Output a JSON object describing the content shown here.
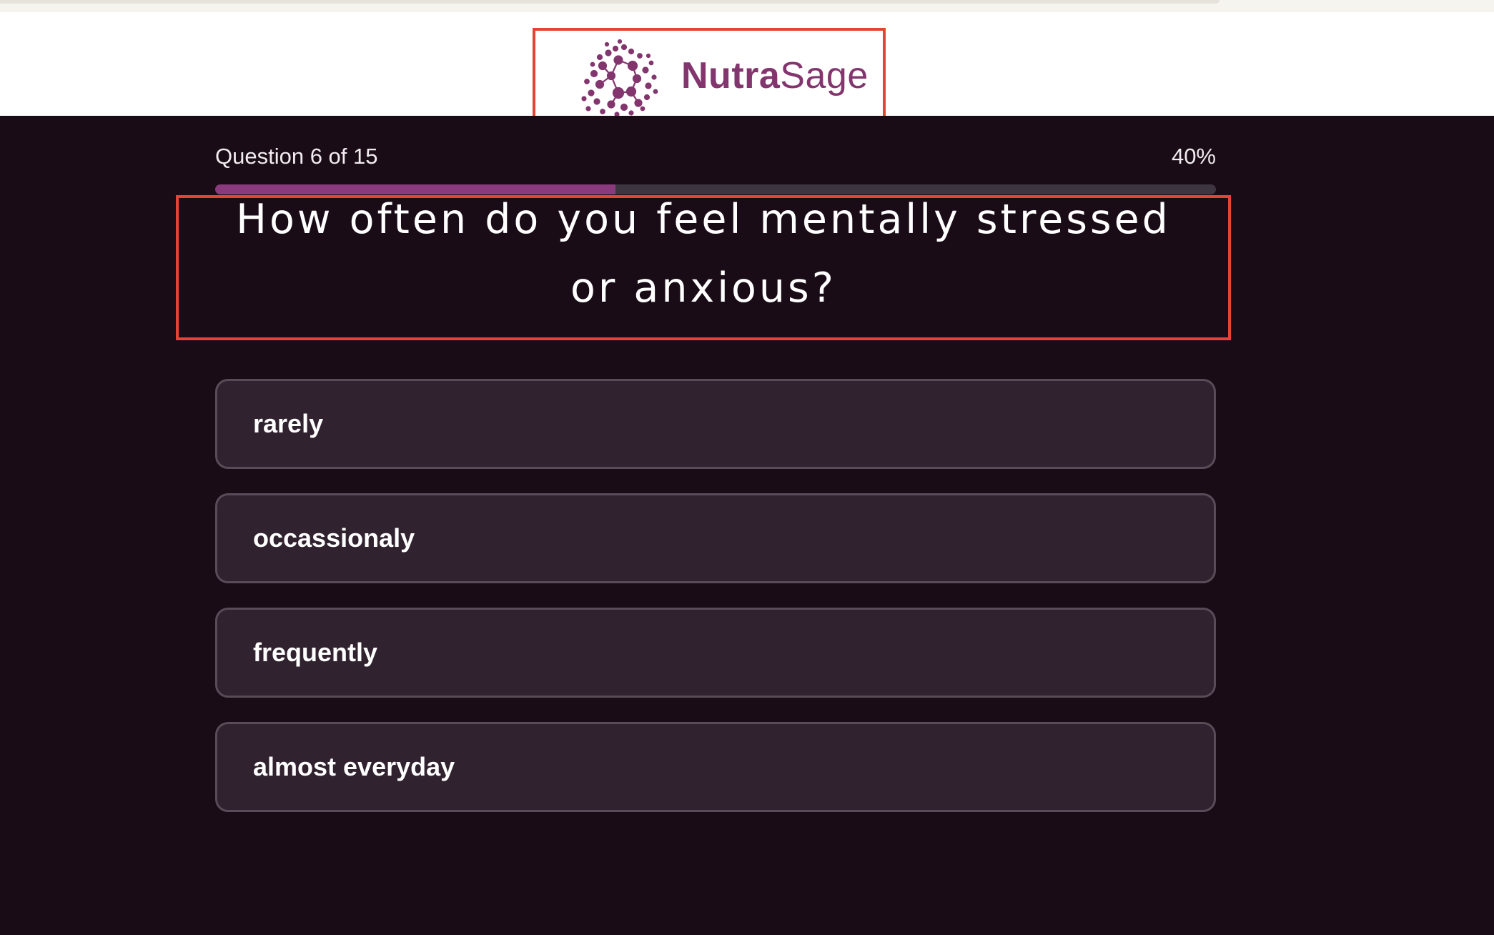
{
  "brand": {
    "name_bold": "Nutra",
    "name_light": "Sage",
    "logo_icon": "molecule-network-icon",
    "color": "#83356e"
  },
  "progress": {
    "label": "Question 6 of 15",
    "percent_label": "40%",
    "fraction": 0.4,
    "fill_color": "#8a3b7d"
  },
  "question": {
    "text": "How often do you feel mentally stressed or anxious?"
  },
  "options": [
    {
      "label": "rarely"
    },
    {
      "label": "occassionaly"
    },
    {
      "label": "frequently"
    },
    {
      "label": "almost everyday"
    }
  ],
  "colors": {
    "background": "#1a0c16",
    "option_bg": "#30222e",
    "highlight_border": "#e54432"
  }
}
